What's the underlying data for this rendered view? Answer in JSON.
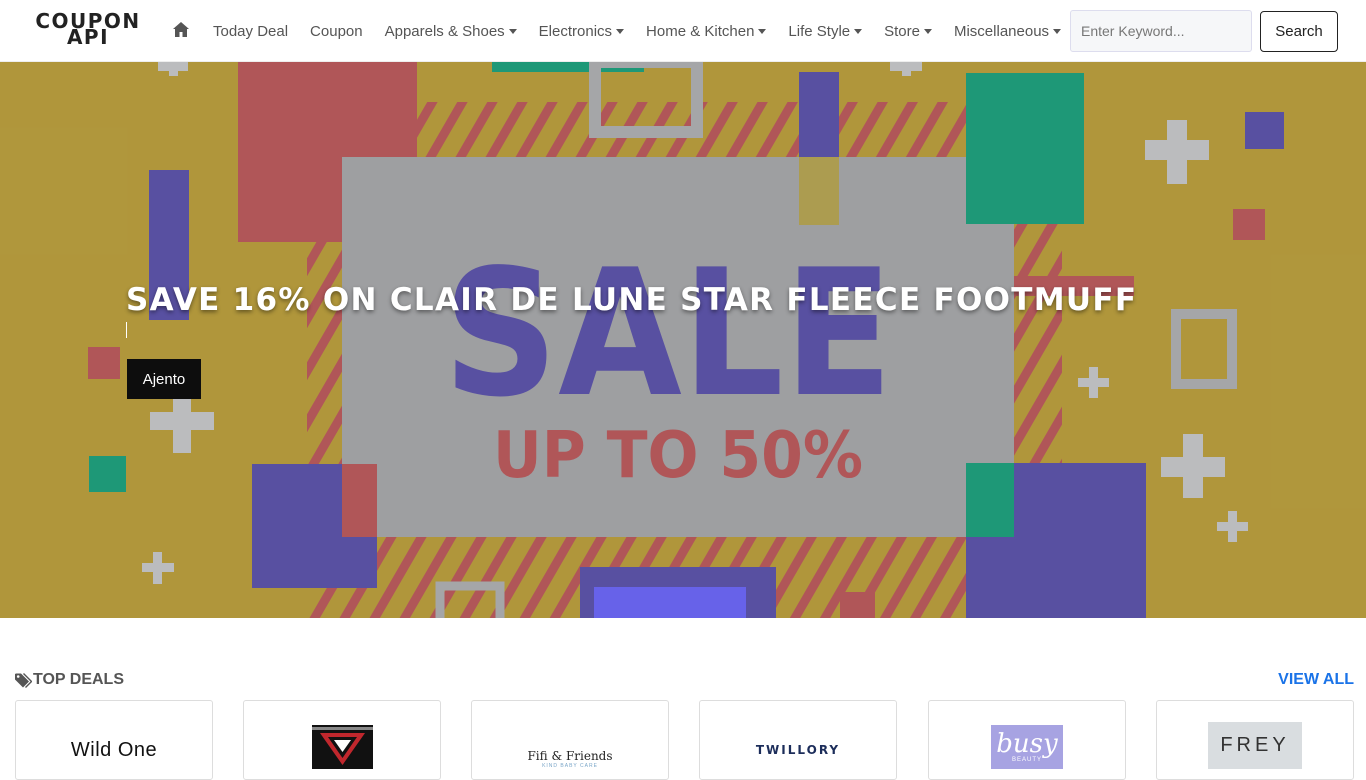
{
  "brand": {
    "line1": "COUPON",
    "line2": "API"
  },
  "nav": {
    "home_icon": "home-icon",
    "items": [
      {
        "label": "Today Deal",
        "dropdown": false
      },
      {
        "label": "Coupon",
        "dropdown": false
      },
      {
        "label": "Apparels & Shoes",
        "dropdown": true
      },
      {
        "label": "Electronics",
        "dropdown": true
      },
      {
        "label": "Home & Kitchen",
        "dropdown": true
      },
      {
        "label": "Life Style",
        "dropdown": true
      },
      {
        "label": "Store",
        "dropdown": true
      },
      {
        "label": "Miscellaneous",
        "dropdown": true
      }
    ]
  },
  "search": {
    "placeholder": "Enter Keyword...",
    "value": "",
    "button_label": "Search"
  },
  "hero": {
    "title": "SAVE 16% ON CLAIR DE LUNE STAR FLEECE FOOTMUFF",
    "button_label": "Ajento",
    "banner_text_main": "SALE",
    "banner_text_sub": "UP TO 50%",
    "colors": {
      "background": "#b49a3d",
      "red": "#b4585a",
      "blue": "#5a52a5",
      "green": "#1f9c7a",
      "grey": "#a2a3a5"
    }
  },
  "top_deals": {
    "heading": "TOP DEALS",
    "icon": "tag-icon",
    "view_all_label": "VIEW ALL",
    "stores": [
      {
        "name": "Wild One"
      },
      {
        "name": ""
      },
      {
        "name": "Fifi & Friends",
        "tagline": "KIND BABY CARE"
      },
      {
        "name": "TWILLORY"
      },
      {
        "name": "busy",
        "tagline": "BEAUTY"
      },
      {
        "name": "FREY"
      }
    ]
  },
  "accent_color": "#1a73e8"
}
